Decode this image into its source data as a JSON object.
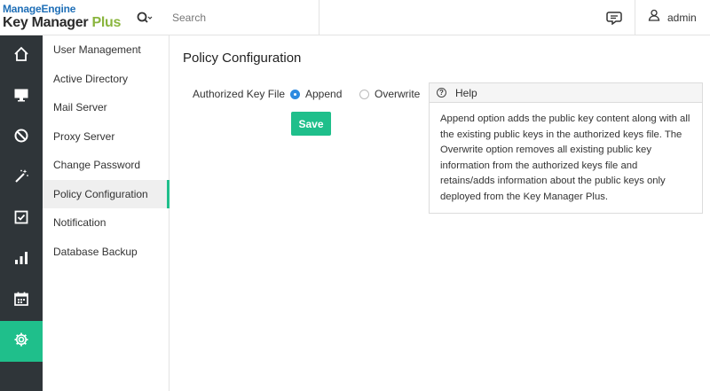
{
  "app": {
    "brand_top": "ManageEngine",
    "brand_bottom": "Key Manager",
    "brand_plus": "Plus"
  },
  "header": {
    "search_placeholder": "Search",
    "user_name": "admin"
  },
  "rail": [
    {
      "icon": "home-icon"
    },
    {
      "icon": "monitor-icon"
    },
    {
      "icon": "block-icon"
    },
    {
      "icon": "magic-wand-icon"
    },
    {
      "icon": "checkbox-icon"
    },
    {
      "icon": "bar-chart-icon"
    },
    {
      "icon": "calendar-icon"
    },
    {
      "icon": "gear-icon",
      "active": true
    }
  ],
  "subnav": {
    "items": [
      {
        "label": "User Management"
      },
      {
        "label": "Active Directory"
      },
      {
        "label": "Mail Server"
      },
      {
        "label": "Proxy Server"
      },
      {
        "label": "Change Password"
      },
      {
        "label": "Policy Configuration",
        "active": true
      },
      {
        "label": "Notification"
      },
      {
        "label": "Database Backup"
      }
    ]
  },
  "main": {
    "title": "Policy Configuration",
    "field_label": "Authorized Key File",
    "option_append": "Append",
    "option_overwrite": "Overwrite",
    "selected": "Append",
    "save_label": "Save"
  },
  "help": {
    "title": "Help",
    "text": "Append option adds the public key content along with all the existing public keys in the authorized keys file. The Overwrite option removes all existing public key information from the authorized keys file and retains/adds information about the public keys only deployed from the Key Manager Plus."
  },
  "colors": {
    "accent": "#1fbf8b",
    "rail_bg": "#2f3539",
    "radio_selected": "#2d8ae0"
  }
}
